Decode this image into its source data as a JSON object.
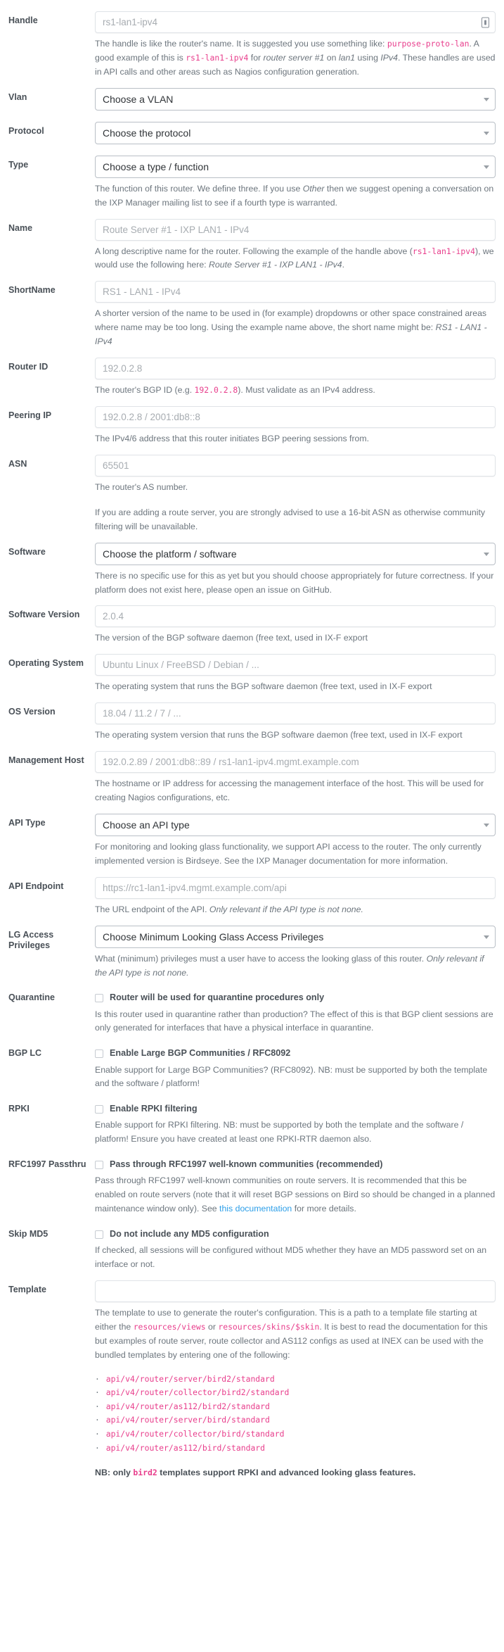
{
  "fields": {
    "handle": {
      "label": "Handle",
      "placeholder": "rs1-lan1-ipv4",
      "icon": "lock-icon",
      "help_1": "The handle is like the router's name. It is suggested you use something like: ",
      "help_code_1": "purpose-proto-lan",
      "help_2": ". A good example of this is ",
      "help_code_2": "rs1-lan1-ipv4",
      "help_3": " for ",
      "help_ital_1": "router server #1",
      "help_4": " on ",
      "help_ital_2": "lan1",
      "help_5": " using ",
      "help_ital_3": "IPv4",
      "help_6": ". These handles are used in API calls and other areas such as Nagios configuration generation."
    },
    "vlan": {
      "label": "Vlan",
      "selected": "Choose a VLAN"
    },
    "protocol": {
      "label": "Protocol",
      "selected": "Choose the protocol"
    },
    "type": {
      "label": "Type",
      "selected": "Choose a type / function",
      "help_1": "The function of this router. We define three. If you use ",
      "help_ital_1": "Other",
      "help_2": " then we suggest opening a conversation on the IXP Manager mailing list to see if a fourth type is warranted."
    },
    "name": {
      "label": "Name",
      "placeholder": "Route Server #1 - IXP LAN1 - IPv4",
      "help_1": "A long descriptive name for the router. Following the example of the handle above (",
      "help_code_1": "rs1-lan1-ipv4",
      "help_2": "), we would use the following here: ",
      "help_ital_1": "Route Server #1 - IXP LAN1 - IPv4",
      "help_3": "."
    },
    "shortname": {
      "label": "ShortName",
      "placeholder": "RS1 - LAN1 - IPv4",
      "help_1": "A shorter version of the name to be used in (for example) dropdowns or other space constrained areas where name may be too long. Using the example name above, the short name might be: ",
      "help_ital_1": "RS1 - LAN1 - IPv4"
    },
    "router_id": {
      "label": "Router ID",
      "placeholder": "192.0.2.8",
      "help_1": "The router's BGP ID (e.g. ",
      "help_code_1": "192.0.2.8",
      "help_2": "). Must validate as an IPv4 address."
    },
    "peering_ip": {
      "label": "Peering IP",
      "placeholder": "192.0.2.8 / 2001:db8::8",
      "help_1": "The IPv4/6 address that this router initiates BGP peering sessions from."
    },
    "asn": {
      "label": "ASN",
      "placeholder": "65501",
      "help_1": "The router's AS number.",
      "help_2": "If you are adding a route server, you are strongly advised to use a 16-bit ASN as otherwise community filtering will be unavailable."
    },
    "software": {
      "label": "Software",
      "selected": "Choose the platform / software",
      "help_1": "There is no specific use for this as yet but you should choose appropriately for future correctness. If your platform does not exist here, please open an issue on GitHub."
    },
    "software_version": {
      "label": "Software Version",
      "placeholder": "2.0.4",
      "help_1": "The version of the BGP software daemon (free text, used in IX-F export"
    },
    "operating_system": {
      "label": "Operating System",
      "placeholder": "Ubuntu Linux / FreeBSD / Debian / ...",
      "help_1": "The operating system that runs the BGP software daemon (free text, used in IX-F export"
    },
    "os_version": {
      "label": "OS Version",
      "placeholder": "18.04 / 11.2 / 7 / ...",
      "help_1": "The operating system version that runs the BGP software daemon (free text, used in IX-F export"
    },
    "management_host": {
      "label": "Management Host",
      "placeholder": "192.0.2.89 / 2001:db8::89 / rs1-lan1-ipv4.mgmt.example.com",
      "help_1": "The hostname or IP address for accessing the management interface of the host. This will be used for creating Nagios configurations, etc."
    },
    "api_type": {
      "label": "API Type",
      "selected": "Choose an API type",
      "help_1": "For monitoring and looking glass functionality, we support API access to the router. The only currently implemented version is Birdseye. See the IXP Manager documentation for more information."
    },
    "api_endpoint": {
      "label": "API Endpoint",
      "placeholder": "https://rc1-lan1-ipv4.mgmt.example.com/api",
      "help_1": "The URL endpoint of the API. ",
      "help_ital_1": "Only relevant if the API type is not none."
    },
    "lg_access": {
      "label": "LG Access Privileges",
      "selected": "Choose Minimum Looking Glass Access Privileges",
      "help_1": "What (minimum) privileges must a user have to access the looking glass of this router. ",
      "help_ital_1": "Only relevant if the API type is not none."
    },
    "quarantine": {
      "label": "Quarantine",
      "checkbox_label": "Router will be used for quarantine procedures only",
      "checked": false,
      "help_1": "Is this router used in quarantine rather than production? The effect of this is that BGP client sessions are only generated for interfaces that have a physical interface in quarantine."
    },
    "bgp_lc": {
      "label": "BGP LC",
      "checkbox_label": "Enable Large BGP Communities / RFC8092",
      "checked": false,
      "help_1": "Enable support for Large BGP Communities? (RFC8092). NB: must be supported by both the template and the software / platform!"
    },
    "rpki": {
      "label": "RPKI",
      "checkbox_label": "Enable RPKI filtering",
      "checked": false,
      "help_1": "Enable support for RPKI filtering. NB: must be supported by both the template and the software / platform! Ensure you have created at least one RPKI-RTR daemon also."
    },
    "rfc1997": {
      "label": "RFC1997 Passthru",
      "checkbox_label": "Pass through RFC1997 well-known communities (recommended)",
      "checked": false,
      "help_1": "Pass through RFC1997 well-known communities on route servers. It is recommended that this be enabled on route servers (note that it will reset BGP sessions on Bird so should be changed in a planned maintenance window only). See ",
      "help_link": "this documentation",
      "help_2": " for more details."
    },
    "skip_md5": {
      "label": "Skip MD5",
      "checkbox_label": "Do not include any MD5 configuration",
      "checked": false,
      "help_1": "If checked, all sessions will be configured without MD5 whether they have an MD5 password set on an interface or not."
    },
    "template": {
      "label": "Template",
      "value": "",
      "help_1": "The template to use to generate the router's configuration. This is a path to a template file starting at either the ",
      "help_code_1": "resources/views",
      "help_2": " or ",
      "help_code_2": "resources/skins/$skin",
      "help_3": ". It is best to read the documentation for this but examples of route server, route collector and AS112 configs as used at INEX can be used with the bundled templates by entering one of the following:",
      "template_paths": [
        "api/v4/router/server/bird2/standard",
        "api/v4/router/collector/bird2/standard",
        "api/v4/router/as112/bird2/standard",
        "api/v4/router/server/bird/standard",
        "api/v4/router/collector/bird/standard",
        "api/v4/router/as112/bird/standard"
      ],
      "nb_1": "NB: only ",
      "nb_code": "bird2",
      "nb_2": " templates support RPKI and advanced looking glass features."
    }
  },
  "colors": {
    "code_pink": "#e83e8c",
    "link_blue": "#2b9ee8",
    "label_grey": "#495057",
    "help_grey": "#6c757d"
  }
}
